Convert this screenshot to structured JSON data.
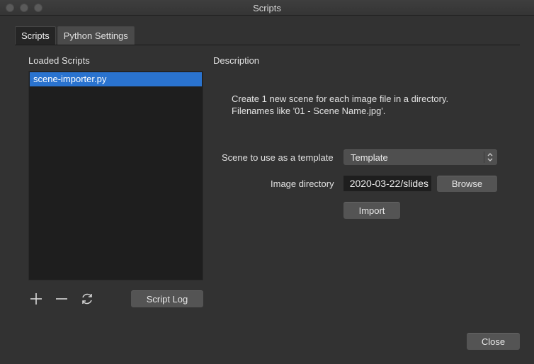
{
  "window": {
    "title": "Scripts"
  },
  "tabs": [
    {
      "label": "Scripts",
      "active": true
    },
    {
      "label": "Python Settings",
      "active": false
    }
  ],
  "left_panel": {
    "heading": "Loaded Scripts",
    "scripts": [
      {
        "name": "scene-importer.py",
        "selected": true
      }
    ],
    "add_icon": "plus-icon",
    "remove_icon": "minus-icon",
    "reload_icon": "refresh-icon",
    "script_log_label": "Script Log"
  },
  "right_panel": {
    "heading": "Description",
    "description_line1": "Create 1 new scene for each image file in a directory.",
    "description_line2": "Filenames like '01 - Scene Name.jpg'.",
    "template_label": "Scene to use as a template",
    "template_value": "Template",
    "image_dir_label": "Image directory",
    "image_dir_value": "2020-03-22/slides",
    "browse_label": "Browse",
    "import_label": "Import"
  },
  "footer": {
    "close_label": "Close"
  },
  "colors": {
    "background": "#323232",
    "selection": "#2a73cf",
    "list_background": "#1e1e1e"
  }
}
